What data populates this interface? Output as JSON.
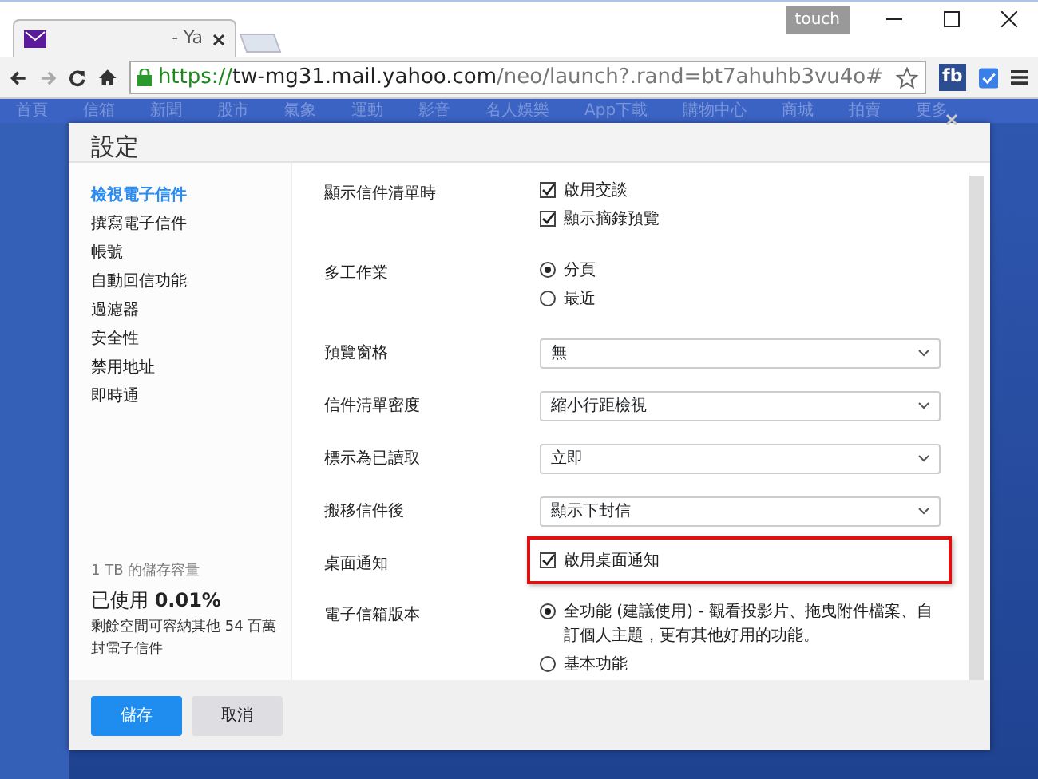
{
  "browser": {
    "tab_title": "- Ya",
    "badge": "touch",
    "url": {
      "scheme": "https://",
      "host": "tw-mg31.mail.yahoo.com",
      "path": "/neo/launch?.rand=bt7ahuhb3vu4o#"
    },
    "extension_label": "fb"
  },
  "nav": [
    "首頁",
    "信箱",
    "新聞",
    "股市",
    "氣象",
    "運動",
    "影音",
    "名人娛樂",
    "App下載",
    "購物中心",
    "商城",
    "拍賣",
    "更多"
  ],
  "dialog": {
    "title": "設定",
    "sidebar": [
      {
        "label": "檢視電子信件",
        "selected": true
      },
      {
        "label": "撰寫電子信件",
        "selected": false
      },
      {
        "label": "帳號",
        "selected": false
      },
      {
        "label": "自動回信功能",
        "selected": false
      },
      {
        "label": "過濾器",
        "selected": false
      },
      {
        "label": "安全性",
        "selected": false
      },
      {
        "label": "禁用地址",
        "selected": false
      },
      {
        "label": "即時通",
        "selected": false
      }
    ],
    "storage": {
      "capacity": "1 TB 的儲存容量",
      "used": "已使用 **0.01%**",
      "remaining": "剩餘空間可容納其他 54 百萬封電子信件"
    },
    "settings": [
      {
        "label": "顯示信件清單時",
        "kind": "checkbox",
        "highlighted": false,
        "options": [
          {
            "text": "啟用交談",
            "checked": true
          },
          {
            "text": "顯示摘錄預覽",
            "checked": true
          }
        ]
      },
      {
        "label": "多工作業",
        "kind": "radio",
        "highlighted": false,
        "options": [
          {
            "text": "分頁",
            "selected": true
          },
          {
            "text": "最近",
            "selected": false
          }
        ]
      },
      {
        "label": "預覽窗格",
        "kind": "select",
        "highlighted": false,
        "value": "無"
      },
      {
        "label": "信件清單密度",
        "kind": "select",
        "highlighted": false,
        "value": "縮小行距檢視"
      },
      {
        "label": "標示為已讀取",
        "kind": "select",
        "highlighted": false,
        "value": "立即"
      },
      {
        "label": "搬移信件後",
        "kind": "select",
        "highlighted": false,
        "value": "顯示下封信"
      },
      {
        "label": "桌面通知",
        "kind": "checkbox",
        "highlighted": true,
        "options": [
          {
            "text": "啟用桌面通知",
            "checked": true
          }
        ]
      },
      {
        "label": "電子信箱版本",
        "kind": "radio",
        "highlighted": false,
        "options": [
          {
            "text": "全功能 (建議使用) - 觀看投影片、拖曳附件檔案、自訂個人主題，更有其他好用的功能。",
            "selected": true
          },
          {
            "text": "基本功能",
            "selected": false
          }
        ]
      }
    ],
    "buttons": [
      {
        "label": "儲存",
        "kind": "primary"
      },
      {
        "label": "取消",
        "kind": "secondary"
      }
    ]
  }
}
